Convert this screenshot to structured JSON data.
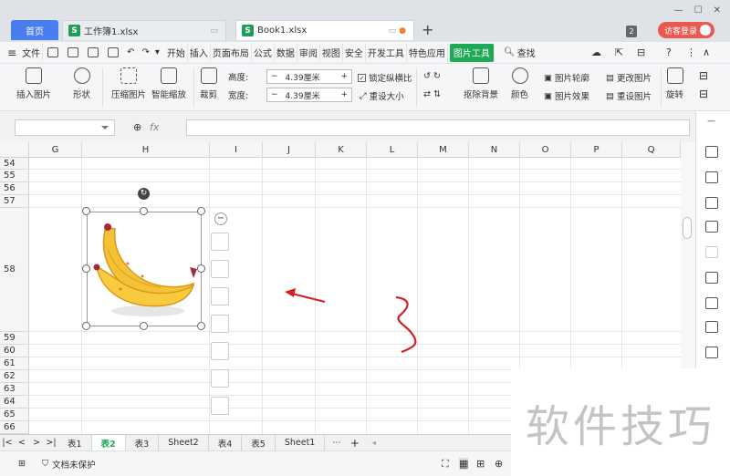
{
  "tabs": {
    "home": "首页",
    "workbook1": "工作簿1.xlsx",
    "book1": "Book1.xlsx",
    "badge": "2",
    "login": "访客登录"
  },
  "menu": {
    "file": "文件",
    "items": [
      "开始",
      "插入",
      "页面布局",
      "公式",
      "数据",
      "审阅",
      "视图",
      "安全",
      "开发工具",
      "特色应用",
      "图片工具"
    ],
    "active": "图片工具",
    "search": "查找"
  },
  "ribbon": {
    "insert_pic": "插入图片",
    "shape": "形状",
    "compress": "压缩图片",
    "smart_scale": "智能缩放",
    "crop": "裁剪",
    "height_label": "高度:",
    "height_value": "4.39厘米",
    "width_label": "宽度:",
    "width_value": "4.39厘米",
    "lock_ratio": "锁定纵横比",
    "reset_size": "重设大小",
    "remove_bg": "抠除背景",
    "color": "颜色",
    "pic_outline": "图片轮廓",
    "pic_effect": "图片效果",
    "change_pic": "更改图片",
    "reset_pic": "重设图片",
    "rotate": "旋转"
  },
  "formula": {
    "fx": "fx"
  },
  "columns": [
    "G",
    "H",
    "I",
    "J",
    "K",
    "L",
    "M",
    "N",
    "O",
    "P",
    "Q"
  ],
  "rows": [
    "54",
    "55",
    "56",
    "57",
    "58",
    "59",
    "60",
    "61",
    "62",
    "63",
    "64",
    "65",
    "66"
  ],
  "sheet_tabs": [
    "表1",
    "表2",
    "表3",
    "Sheet2",
    "表4",
    "表5",
    "Sheet1"
  ],
  "active_sheet": "表2",
  "status": {
    "protect": "文档未保护"
  },
  "watermark": "软件技巧",
  "colors": {
    "accent": "#1fa855",
    "home_tab": "#4a7ef0",
    "annotation": "#d42020",
    "login": "#e85a4f"
  }
}
